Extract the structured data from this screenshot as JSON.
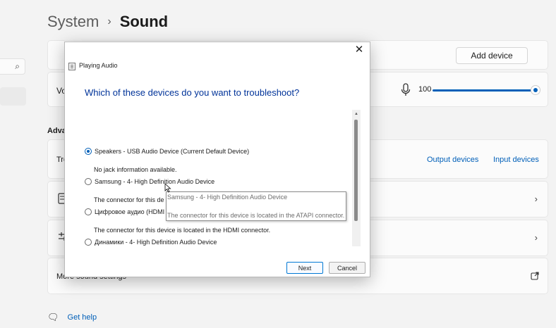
{
  "breadcrumb": {
    "parent": "System",
    "separator": "›",
    "current": "Sound"
  },
  "nav": {
    "search_icon": "⌕"
  },
  "add_device": {
    "label": "Add device"
  },
  "volume": {
    "label": "Vo",
    "value": "100",
    "level_percent": 100,
    "accent": "#005fb8"
  },
  "advanced": {
    "heading": "Adva"
  },
  "troubleshoot_row": {
    "label": "Tro",
    "output_link": "Output devices",
    "input_link": "Input devices"
  },
  "device_rows": {
    "chevron": "›"
  },
  "more_settings": {
    "label": "More sound settings"
  },
  "help": {
    "icon": "🗨",
    "label": "Get help"
  },
  "dialog": {
    "app_title": "Playing Audio",
    "close": "✕",
    "question": "Which of these devices do you want to troubleshoot?",
    "options": [
      {
        "label": "Speakers  - USB Audio Device (Current Default Device)",
        "description": "No jack information available.",
        "selected": true
      },
      {
        "label": "Samsung - 4- High Definition Audio Device",
        "description": "The connector for this de",
        "selected": false
      },
      {
        "label": "Цифровое аудио (HDMI",
        "description": "The connector for this device is located in the HDMI connector.",
        "selected": false
      },
      {
        "label": "Динамики - 4- High Definition Audio Device",
        "description": "",
        "selected": false
      }
    ],
    "tooltip": {
      "title": "Samsung - 4- High Definition Audio Device",
      "text": "The connector for this device is located in the ATAPI connector."
    },
    "scroll_up": "▲",
    "next_label": "Next",
    "cancel_label": "Cancel"
  }
}
